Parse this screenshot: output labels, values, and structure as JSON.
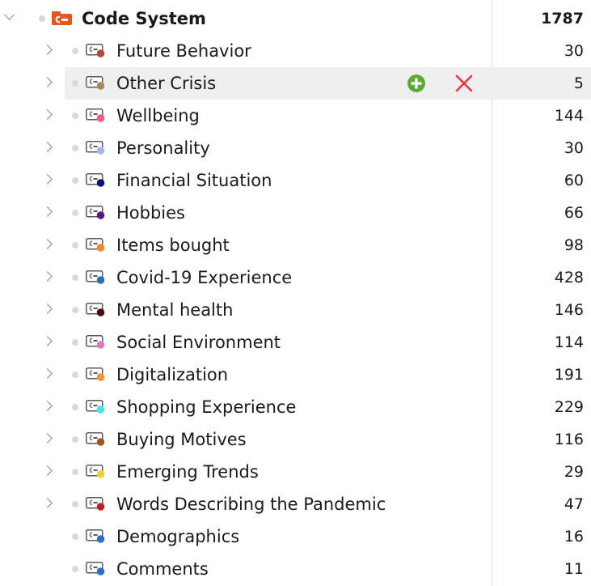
{
  "root": {
    "label": "Code System",
    "count": "1787",
    "icon": "code-system-folder-icon",
    "icon_color": "#e6551e"
  },
  "hovered_row_actions": {
    "add_icon": "add-circle-icon",
    "add_color": "#5aab34",
    "remove_icon": "delete-x-icon",
    "remove_color": "#e0393e"
  },
  "codes": [
    {
      "label": "Future Behavior",
      "count": "30",
      "color": "#b44a3a",
      "expandable": true
    },
    {
      "label": "Other Crisis",
      "count": "5",
      "color": "#a7865a",
      "expandable": true
    },
    {
      "label": "Wellbeing",
      "count": "144",
      "color": "#ee5b8c",
      "expandable": true
    },
    {
      "label": "Personality",
      "count": "30",
      "color": "#a9b2f0",
      "expandable": true
    },
    {
      "label": "Financial Situation",
      "count": "60",
      "color": "#0c1173",
      "expandable": true
    },
    {
      "label": "Hobbies",
      "count": "66",
      "color": "#5b1880",
      "expandable": true
    },
    {
      "label": "Items bought",
      "count": "98",
      "color": "#f2872b",
      "expandable": true
    },
    {
      "label": "Covid-19 Experience",
      "count": "428",
      "color": "#2f6db8",
      "expandable": true
    },
    {
      "label": "Mental health",
      "count": "146",
      "color": "#4a0a10",
      "expandable": true
    },
    {
      "label": "Social Environment",
      "count": "114",
      "color": "#d97fbf",
      "expandable": true
    },
    {
      "label": "Digitalization",
      "count": "191",
      "color": "#f29438",
      "expandable": true
    },
    {
      "label": "Shopping Experience",
      "count": "229",
      "color": "#3ee6ee",
      "expandable": true
    },
    {
      "label": "Buying Motives",
      "count": "116",
      "color": "#9a5a26",
      "expandable": true
    },
    {
      "label": "Emerging Trends",
      "count": "29",
      "color": "#f0d02c",
      "expandable": true
    },
    {
      "label": "Words Describing the Pandemic",
      "count": "47",
      "color": "#c41e22",
      "expandable": true
    },
    {
      "label": "Demographics",
      "count": "16",
      "color": "#2c6fbe",
      "expandable": false
    },
    {
      "label": "Comments",
      "count": "11",
      "color": "#2c6fbe",
      "expandable": false
    }
  ]
}
